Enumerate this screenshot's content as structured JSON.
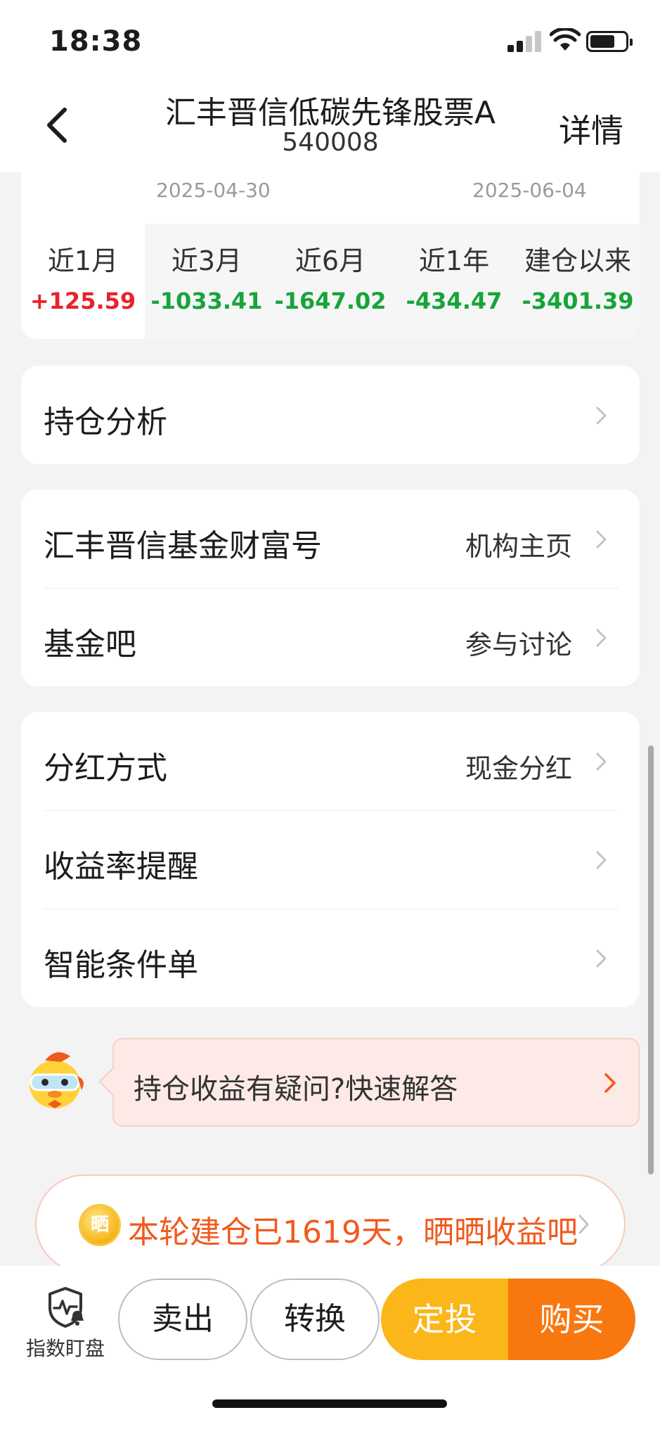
{
  "status_bar": {
    "time": "18:38"
  },
  "nav": {
    "title": "汇丰晋信低碳先锋股票A",
    "code": "540008",
    "detail_label": "详情"
  },
  "returns": {
    "date_start": "2025-04-30",
    "date_end": "2025-06-04",
    "periods": [
      {
        "label": "近1月",
        "value": "+125.59"
      },
      {
        "label": "近3月",
        "value": "-1033.41"
      },
      {
        "label": "近6月",
        "value": "-1647.02"
      },
      {
        "label": "近1年",
        "value": "-434.47"
      },
      {
        "label": "建仓以来",
        "value": "-3401.39"
      }
    ],
    "colors": {
      "positive": "#e6232a",
      "negative": "#17a43a"
    }
  },
  "holdings_card": {
    "title": "持仓分析"
  },
  "org_card": {
    "rows": [
      {
        "title": "汇丰晋信基金财富号",
        "right": "机构主页"
      },
      {
        "title": "基金吧",
        "right": "参与讨论"
      }
    ]
  },
  "settings_card": {
    "rows": [
      {
        "title": "分红方式",
        "right": "现金分红"
      },
      {
        "title": "收益率提醒",
        "right": ""
      },
      {
        "title": "智能条件单",
        "right": ""
      }
    ]
  },
  "help": {
    "text": "持仓收益有疑问?快速解答"
  },
  "share": {
    "coin_char": "晒",
    "text": "本轮建仓已1619天，晒晒收益吧"
  },
  "bottom_bar": {
    "watch_label": "指数盯盘",
    "sell": "卖出",
    "switch": "转换",
    "plan": "定投",
    "buy": "购买"
  },
  "icons": {
    "back": "chevron-left-icon",
    "row_arrow": "chevron-right-icon",
    "watch": "shield-pulse-bell-icon",
    "coin": "coin-icon",
    "mascot": "duck-mascot-icon"
  }
}
